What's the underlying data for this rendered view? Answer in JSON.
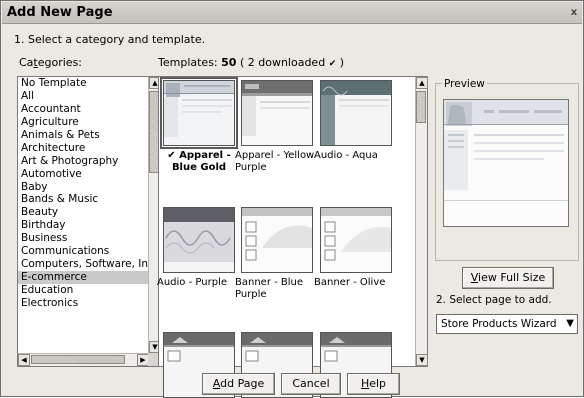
{
  "window": {
    "title": "Add New Page",
    "close_glyph": "x"
  },
  "step1": {
    "label": "1. Select a category and template."
  },
  "categories": {
    "label_prefix": "Ca",
    "label_underlined": "t",
    "label_suffix": "egories:",
    "items": [
      "No Template",
      "All",
      "Accountant",
      "Agriculture",
      "Animals & Pets",
      "Architecture",
      "Art & Photography",
      "Automotive",
      "Baby",
      "Bands & Music",
      "Beauty",
      "Birthday",
      "Business",
      "Communications",
      "Computers, Software, In",
      "E-commerce",
      "Education",
      "Electronics"
    ],
    "selected": "E-commerce"
  },
  "templates": {
    "label": "Templates:",
    "count": "50",
    "downloaded": "( 2 downloaded",
    "downloaded_close": ")",
    "tiles": [
      {
        "label": "Apparel - Blue Gold",
        "check": "✔",
        "selected": true,
        "theme": "blue-gold"
      },
      {
        "label": "Apparel - Yellow Purple",
        "selected": false,
        "theme": "yellow-purple"
      },
      {
        "label": "Audio - Aqua",
        "selected": false,
        "theme": "audio-aqua"
      },
      {
        "label": "Audio - Purple",
        "selected": false,
        "theme": "audio-purple"
      },
      {
        "label": "Banner - Blue Purple",
        "selected": false,
        "theme": "banner-blue"
      },
      {
        "label": "Banner - Olive",
        "selected": false,
        "theme": "banner-olive"
      },
      {
        "label": "",
        "selected": false,
        "theme": "row3"
      },
      {
        "label": "",
        "selected": false,
        "theme": "row3"
      },
      {
        "label": "",
        "selected": false,
        "theme": "row3"
      }
    ]
  },
  "preview": {
    "legend": "Preview"
  },
  "buttons": {
    "view_full_size_u": "V",
    "view_full_size_rest": "iew Full Size",
    "add_page_u": "A",
    "add_page_rest": "dd Page",
    "cancel": "Cancel",
    "help_u": "H",
    "help_rest": "elp"
  },
  "step2": {
    "label": "2. Select page to add.",
    "selected_value": "Store Products Wizard"
  }
}
